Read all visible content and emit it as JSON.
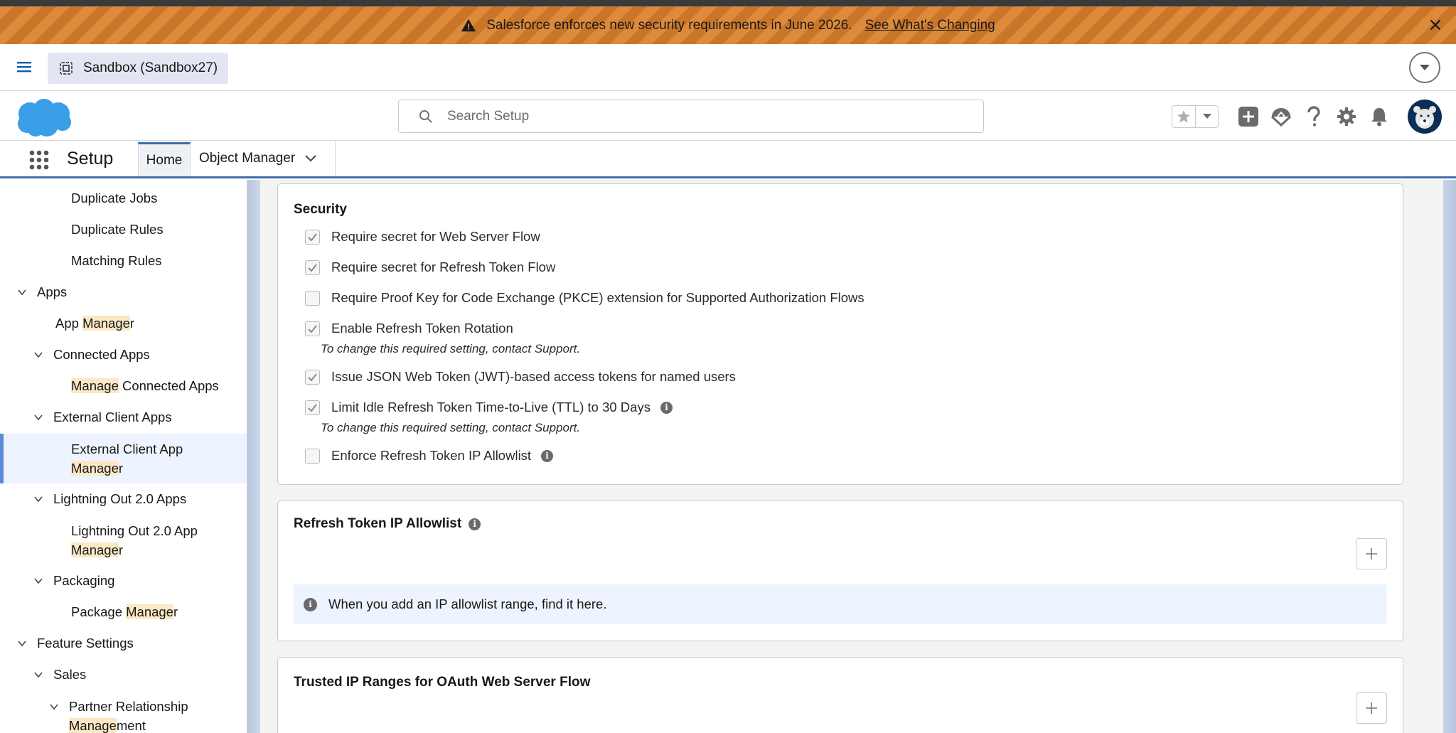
{
  "banner": {
    "message": "Salesforce enforces new security requirements in June 2026.",
    "link": "See What's Changing",
    "color": "#dd8a3b"
  },
  "sandbox_bar": {
    "org_label": "Sandbox (Sandbox27)"
  },
  "header": {
    "search_placeholder": "Search Setup",
    "icons": [
      "star-icon",
      "chevron-down-icon",
      "plus-icon",
      "trailhead-icon",
      "help-icon",
      "gear-icon",
      "bell-icon",
      "avatar"
    ]
  },
  "nav": {
    "app_name": "Setup",
    "tabs": [
      {
        "label": "Home",
        "active": true
      },
      {
        "label": "Object Manager",
        "dropdown": true
      }
    ],
    "accent": "#3e6ea8"
  },
  "sidebar": {
    "items": [
      {
        "pre": "Duplicate Jobs",
        "hl": "",
        "post": "",
        "level": 3,
        "expandable": false
      },
      {
        "pre": "Duplicate Rules",
        "hl": "",
        "post": "",
        "level": 3,
        "expandable": false
      },
      {
        "pre": "Matching Rules",
        "hl": "",
        "post": "",
        "level": 3,
        "expandable": false
      },
      {
        "pre": "Apps",
        "hl": "",
        "post": "",
        "level": 1,
        "expandable": true
      },
      {
        "pre": "App ",
        "hl": "Manage",
        "post": "r",
        "level": 2,
        "expandable": false
      },
      {
        "pre": "Connected Apps",
        "hl": "",
        "post": "",
        "level": 2,
        "expandable": true
      },
      {
        "pre": "",
        "hl": "Manage",
        "post": " Connected Apps",
        "level": 3,
        "expandable": false
      },
      {
        "pre": "External Client Apps",
        "hl": "",
        "post": "",
        "level": 2,
        "expandable": true
      },
      {
        "line1": "External Client App",
        "pre": "",
        "hl": "Manage",
        "post": "r",
        "level": 3,
        "expandable": false,
        "selected": true
      },
      {
        "pre": "Lightning Out 2.0 Apps",
        "hl": "",
        "post": "",
        "level": 2,
        "expandable": true
      },
      {
        "line1": "Lightning Out 2.0 App",
        "pre": "",
        "hl": "Manage",
        "post": "r",
        "level": 3,
        "expandable": false
      },
      {
        "pre": "Packaging",
        "hl": "",
        "post": "",
        "level": 2,
        "expandable": true
      },
      {
        "pre": "Package ",
        "hl": "Manage",
        "post": "r",
        "level": 3,
        "expandable": false
      },
      {
        "pre": "Feature Settings",
        "hl": "",
        "post": "",
        "level": 1,
        "expandable": true
      },
      {
        "pre": "Sales",
        "hl": "",
        "post": "",
        "level": 2,
        "expandable": true
      },
      {
        "line1": "Partner Relationship",
        "pre": "",
        "hl": "Manage",
        "post": "ment",
        "level": 3,
        "expandable": true
      }
    ],
    "selected_color": "#eef4ff",
    "highlight_color": "#fbe8c4"
  },
  "security": {
    "title": "Security",
    "options": [
      {
        "label": "Require secret for Web Server Flow",
        "checked": true,
        "disabled": true,
        "info": false
      },
      {
        "label": "Require secret for Refresh Token Flow",
        "checked": true,
        "disabled": true,
        "info": false
      },
      {
        "label": "Require Proof Key for Code Exchange (PKCE) extension for Supported Authorization Flows",
        "checked": false,
        "disabled": false,
        "info": false
      },
      {
        "label": "Enable Refresh Token Rotation",
        "checked": true,
        "disabled": true,
        "info": false,
        "note": "To change this required setting, contact Support."
      },
      {
        "label": "Issue JSON Web Token (JWT)-based access tokens for named users",
        "checked": true,
        "disabled": true,
        "info": false
      },
      {
        "label": "Limit Idle Refresh Token Time-to-Live (TTL) to 30 Days",
        "checked": true,
        "disabled": true,
        "info": true,
        "note": "To change this required setting, contact Support."
      },
      {
        "label": "Enforce Refresh Token IP Allowlist",
        "checked": false,
        "disabled": false,
        "info": true
      }
    ]
  },
  "allowlist": {
    "title": "Refresh Token IP Allowlist",
    "empty_message": "When you add an IP allowlist range, find it here."
  },
  "trusted_ranges": {
    "title": "Trusted IP Ranges for OAuth Web Server Flow"
  }
}
